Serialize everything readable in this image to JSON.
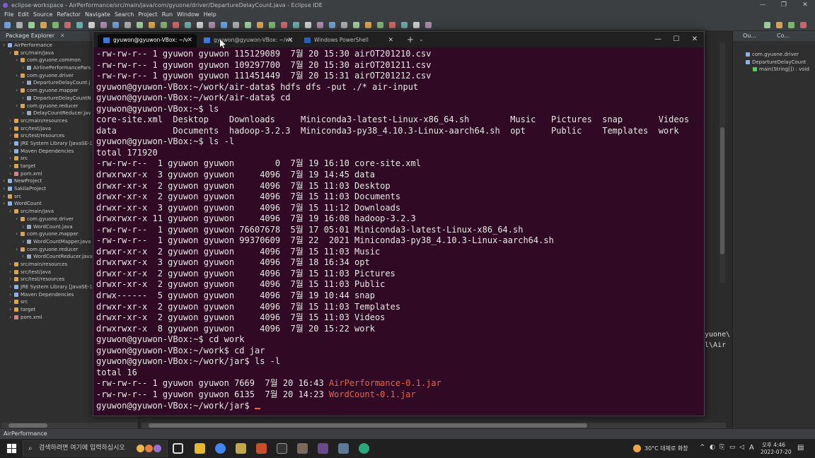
{
  "eclipse": {
    "title": "eclipse-workspace - AirPerformance/src/main/java/com/gyuone/driver/DepartureDelayCount.java - Eclipse IDE",
    "menu": [
      "File",
      "Edit",
      "Source",
      "Refactor",
      "Navigate",
      "Search",
      "Project",
      "Run",
      "Window",
      "Help"
    ],
    "package_explorer_tab": "Package Explorer",
    "tree": [
      {
        "label": "AirPerformance",
        "indent": 0,
        "color": "#8fb3e0"
      },
      {
        "label": "src/main/java",
        "indent": 1,
        "color": "#d6a656"
      },
      {
        "label": "com.gyuone.common",
        "indent": 2,
        "color": "#d6a656"
      },
      {
        "label": "AirlinePerformancePars",
        "indent": 3,
        "color": "#9ab"
      },
      {
        "label": "com.gyuone.driver",
        "indent": 2,
        "color": "#d6a656"
      },
      {
        "label": "DepartureDelayCount.j",
        "indent": 3,
        "color": "#9ab"
      },
      {
        "label": "com.gyuone.mapper",
        "indent": 2,
        "color": "#d6a656"
      },
      {
        "label": "DepartureDelayCountN",
        "indent": 3,
        "color": "#9ab"
      },
      {
        "label": "com.gyuone.reducer",
        "indent": 2,
        "color": "#d6a656"
      },
      {
        "label": "DelayCountReducer.jav",
        "indent": 3,
        "color": "#9ab"
      },
      {
        "label": "src/main/resources",
        "indent": 1,
        "color": "#d6a656"
      },
      {
        "label": "src/test/java",
        "indent": 1,
        "color": "#d6a656"
      },
      {
        "label": "src/test/resources",
        "indent": 1,
        "color": "#d6a656"
      },
      {
        "label": "JRE System Library [JavaSE-1",
        "indent": 1,
        "color": "#8fb3e0"
      },
      {
        "label": "Maven Dependencies",
        "indent": 1,
        "color": "#8fb3e0"
      },
      {
        "label": "src",
        "indent": 1,
        "color": "#d6a656"
      },
      {
        "label": "target",
        "indent": 1,
        "color": "#d6a656"
      },
      {
        "label": "pom.xml",
        "indent": 1,
        "color": "#c88"
      },
      {
        "label": "NewProject",
        "indent": 0,
        "color": "#8fb3e0"
      },
      {
        "label": "SakilaProject",
        "indent": 0,
        "color": "#8fb3e0"
      },
      {
        "label": "src",
        "indent": 0,
        "color": "#d6a656"
      },
      {
        "label": "WordCount",
        "indent": 0,
        "color": "#8fb3e0"
      },
      {
        "label": "src/main/java",
        "indent": 1,
        "color": "#d6a656"
      },
      {
        "label": "com.gyuone.driver",
        "indent": 2,
        "color": "#d6a656"
      },
      {
        "label": "WordCount.java",
        "indent": 3,
        "color": "#9ab"
      },
      {
        "label": "com.gyuone.mapper",
        "indent": 2,
        "color": "#d6a656"
      },
      {
        "label": "WordCountMapper.java",
        "indent": 3,
        "color": "#9ab"
      },
      {
        "label": "com.gyuone.reducer",
        "indent": 2,
        "color": "#d6a656"
      },
      {
        "label": "WordCountReducer.java",
        "indent": 3,
        "color": "#9ab"
      },
      {
        "label": "src/main/resources",
        "indent": 1,
        "color": "#d6a656"
      },
      {
        "label": "src/test/java",
        "indent": 1,
        "color": "#d6a656"
      },
      {
        "label": "src/test/resources",
        "indent": 1,
        "color": "#d6a656"
      },
      {
        "label": "JRE System Library [JavaSE-1",
        "indent": 1,
        "color": "#8fb3e0"
      },
      {
        "label": "Maven Dependencies",
        "indent": 1,
        "color": "#8fb3e0"
      },
      {
        "label": "src",
        "indent": 1,
        "color": "#d6a656"
      },
      {
        "label": "target",
        "indent": 1,
        "color": "#d6a656"
      },
      {
        "label": "pom.xml",
        "indent": 1,
        "color": "#c88"
      }
    ],
    "outline_tab": "Ou...",
    "outline_tab2": "Co...",
    "outline": [
      {
        "label": "com.gyuone.driver",
        "indent": 1
      },
      {
        "label": "DepartureDelayCount",
        "indent": 1
      },
      {
        "label": "main(String[]) : void",
        "indent": 2
      }
    ],
    "editor_peek": [
      "yuone\\",
      "l\\Air"
    ],
    "status": "AirPerformance"
  },
  "terminal": {
    "tabs": [
      {
        "label": "gyuwon@gyuwon-VBox: ~/v",
        "active": true
      },
      {
        "label": "gyuwon@gyuwon-VBox: ~/wc",
        "active": false
      },
      {
        "label": "Windows PowerShell",
        "active": false
      }
    ],
    "newtab_label": "+",
    "dropdown_label": "⌄",
    "lines": [
      {
        "t": "-rw-rw-r-- 1 gyuwon gyuwon 115129089  7월 20 15:30 airOT201210.csv"
      },
      {
        "t": "-rw-rw-r-- 1 gyuwon gyuwon 109297700  7월 20 15:30 airOT201211.csv"
      },
      {
        "t": "-rw-rw-r-- 1 gyuwon gyuwon 111451449  7월 20 15:31 airOT201212.csv"
      },
      {
        "t": "gyuwon@gyuwon-VBox:~/work/air-data$ hdfs dfs -put ./* air-input"
      },
      {
        "t": "gyuwon@gyuwon-VBox:~/work/air-data$ cd"
      },
      {
        "t": "gyuwon@gyuwon-VBox:~$ ls"
      },
      {
        "t": "core-site.xml  Desktop    Downloads     Miniconda3-latest-Linux-x86_64.sh        Music   Pictures  snap       Videos"
      },
      {
        "t": "data           Documents  hadoop-3.2.3  Miniconda3-py38_4.10.3-Linux-aarch64.sh  opt     Public    Templates  work"
      },
      {
        "t": "gyuwon@gyuwon-VBox:~$ ls -l"
      },
      {
        "t": "total 171920"
      },
      {
        "t": "-rw-rw-r--  1 gyuwon gyuwon        0  7월 19 16:10 core-site.xml"
      },
      {
        "t": "drwxrwxr-x  3 gyuwon gyuwon     4096  7월 19 14:45 data"
      },
      {
        "t": "drwxr-xr-x  2 gyuwon gyuwon     4096  7월 15 11:03 Desktop"
      },
      {
        "t": "drwxr-xr-x  2 gyuwon gyuwon     4096  7월 15 11:03 Documents"
      },
      {
        "t": "drwxr-xr-x  3 gyuwon gyuwon     4096  7월 15 11:12 Downloads"
      },
      {
        "t": "drwxrwxr-x 11 gyuwon gyuwon     4096  7월 19 16:08 hadoop-3.2.3"
      },
      {
        "t": "-rw-rw-r--  1 gyuwon gyuwon 76607678  5월 17 05:01 Miniconda3-latest-Linux-x86_64.sh"
      },
      {
        "t": "-rw-rw-r--  1 gyuwon gyuwon 99370609  7월 22  2021 Miniconda3-py38_4.10.3-Linux-aarch64.sh"
      },
      {
        "t": "drwxr-xr-x  2 gyuwon gyuwon     4096  7월 15 11:03 Music"
      },
      {
        "t": "drwxrwxr-x  3 gyuwon gyuwon     4096  7월 18 16:34 opt"
      },
      {
        "t": "drwxr-xr-x  2 gyuwon gyuwon     4096  7월 15 11:03 Pictures"
      },
      {
        "t": "drwxr-xr-x  2 gyuwon gyuwon     4096  7월 15 11:03 Public"
      },
      {
        "t": "drwx------  5 gyuwon gyuwon     4096  7월 19 10:44 snap"
      },
      {
        "t": "drwxr-xr-x  2 gyuwon gyuwon     4096  7월 15 11:03 Templates"
      },
      {
        "t": "drwxr-xr-x  2 gyuwon gyuwon     4096  7월 15 11:03 Videos"
      },
      {
        "t": "drwxrwxr-x  8 gyuwon gyuwon     4096  7월 20 15:22 work"
      },
      {
        "t": "gyuwon@gyuwon-VBox:~$ cd work"
      },
      {
        "t": "gyuwon@gyuwon-VBox:~/work$ cd jar"
      },
      {
        "t": "gyuwon@gyuwon-VBox:~/work/jar$ ls -l"
      },
      {
        "t": "total 16"
      },
      {
        "t": "-rw-rw-r-- 1 gyuwon gyuwon 7669  7월 20 16:43 ",
        "red": "AirPerformance-0.1.jar"
      },
      {
        "t": "-rw-rw-r-- 1 gyuwon gyuwon 6135  7월 20 14:23 ",
        "red": "WordCount-0.1.jar"
      },
      {
        "t": "gyuwon@gyuwon-VBox:~/work/jar$ ",
        "cursor": true
      }
    ]
  },
  "taskbar": {
    "search_placeholder": "검색하려면 여기에 입력하십시오",
    "weather": "30°C  대체로 화창",
    "ime": "A",
    "time_ampm": "오후 4:46",
    "date": "2022-07-20"
  }
}
